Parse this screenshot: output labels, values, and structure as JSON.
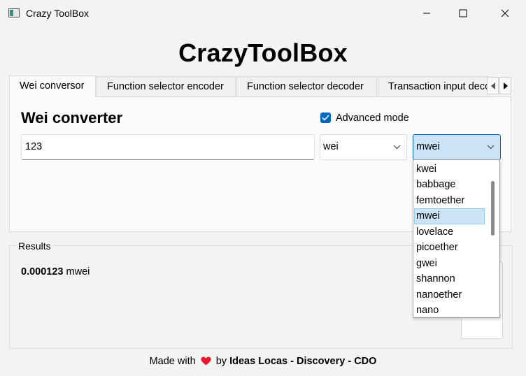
{
  "window": {
    "title": "Crazy ToolBox",
    "controls": [
      "minimize-icon",
      "maximize-icon",
      "close-icon"
    ]
  },
  "app": {
    "heading": "CrazyToolBox"
  },
  "tabs": [
    {
      "label": "Wei conversor",
      "active": true
    },
    {
      "label": "Function selector encoder",
      "active": false
    },
    {
      "label": "Function selector decoder",
      "active": false
    },
    {
      "label": "Transaction input decoder",
      "active": false
    }
  ],
  "converter": {
    "title": "Wei converter",
    "advanced_mode_label": "Advanced mode",
    "advanced_mode_checked": true,
    "amount_value": "123",
    "from_unit": "wei",
    "to_unit": "mwei"
  },
  "unit_dropdown": {
    "items": [
      "kwei",
      "babbage",
      "femtoether",
      "mwei",
      "lovelace",
      "picoether",
      "gwei",
      "shannon",
      "nanoether",
      "nano"
    ],
    "selected": "mwei"
  },
  "results": {
    "group_title": "Results",
    "value": "0.000123",
    "unit": "mwei"
  },
  "footer": {
    "made_with": "Made with",
    "by": "by",
    "credit": "Ideas Locas - Discovery - CDO"
  },
  "colors": {
    "accent": "#0067c0",
    "selection": "#cce4f7",
    "heart": "#e8192c"
  }
}
